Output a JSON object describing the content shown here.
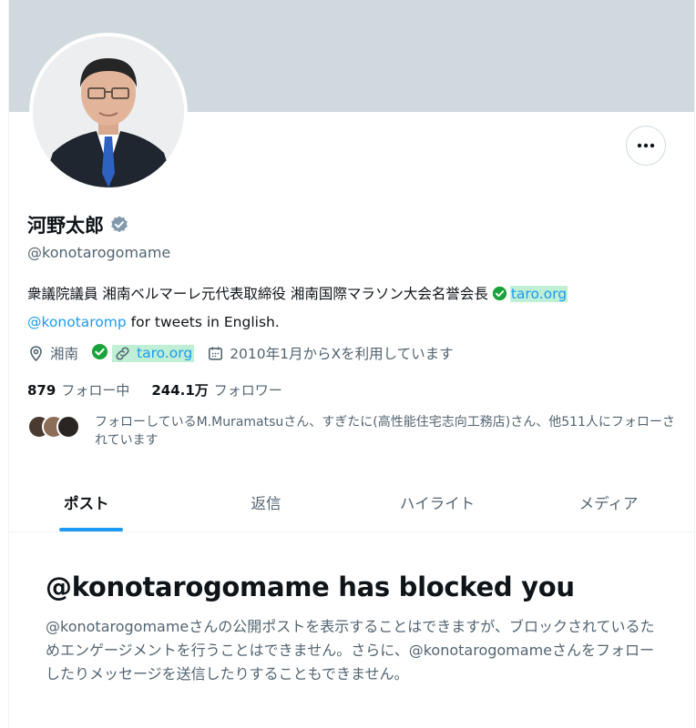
{
  "profile": {
    "name": "河野太郎",
    "handle": "@konotarogomame",
    "bio_text": "衆議院議員 湘南ベルマーレ元代表取締役 湘南国際マラソン大会名誉会長",
    "bio_link": "taro.org",
    "bio_mention": "@konotaromp",
    "bio_suffix": " for tweets in English.",
    "location": "湘南",
    "website": "taro.org",
    "joined": "2010年1月からXを利用しています",
    "following_count": "879",
    "following_label": "フォロー中",
    "followers_count": "244.1万",
    "followers_label": "フォロワー",
    "known_followers": "フォローしているM.Muramatsuさん、すぎたに(高性能住宅志向工務店)さん、他511人にフォローされています"
  },
  "tabs": [
    {
      "label": "ポスト"
    },
    {
      "label": "返信"
    },
    {
      "label": "ハイライト"
    },
    {
      "label": "メディア"
    }
  ],
  "blocked": {
    "title": "@konotarogomame has blocked you",
    "message": "@konotarogomameさんの公開ポストを表示することはできますが、ブロックされているためエンゲージメントを行うことはできません。さらに、@konotarogomameさんをフォローしたりメッセージを送信したりすることもできません。"
  },
  "colors": {
    "accent": "#1d9bf0",
    "banner": "#cfd9de",
    "highlight": "#bfefd4",
    "verified_badge": "#829aab",
    "check_green": "#1aa33a"
  },
  "icons": [
    "more-icon",
    "verified-badge-icon",
    "check-circle-icon",
    "location-icon",
    "link-icon",
    "calendar-icon"
  ]
}
